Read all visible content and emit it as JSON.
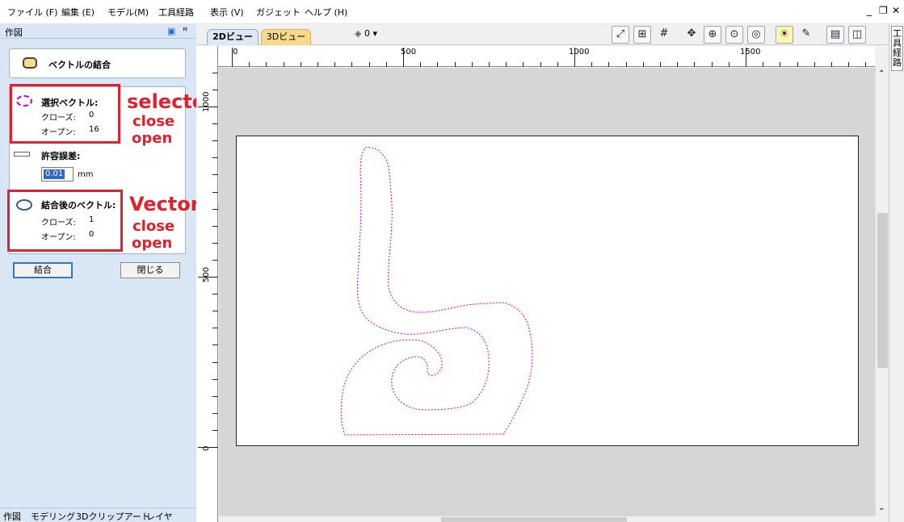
{
  "menu": {
    "items": [
      "ファイル (F)",
      "編集 (E)",
      "モデル(M)",
      "工具経路",
      "表示 (V)",
      "ガジェット",
      "ヘルプ (H)"
    ],
    "window_controls": [
      "_",
      "❐",
      "✕"
    ]
  },
  "panel": {
    "title": "作図",
    "tool_title": "ベクトルの結合",
    "selected": {
      "label": "選択ベクトル:",
      "close_label": "クローズ:",
      "close_value": "0",
      "open_label": "オープン:",
      "open_value": "16"
    },
    "tolerance": {
      "label": "許容誤差:",
      "value": "0.01",
      "unit": "mm"
    },
    "result": {
      "label": "結合後のベクトル:",
      "close_label": "クローズ:",
      "close_value": "1",
      "open_label": "オープン:",
      "open_value": "0"
    },
    "join_button": "結合",
    "close_button": "閉じる"
  },
  "annotations": {
    "selected_title": "selected vector",
    "selected_close": "close",
    "selected_open": "open",
    "result_title": "Vector after united",
    "result_close": "close",
    "result_open": "open"
  },
  "bottom_tabs": [
    "作図",
    "モデリング",
    "3Dクリップアート",
    "レイヤ"
  ],
  "right_tab": "工具経路",
  "view_tabs": [
    "2Dビュー",
    "3Dビュー"
  ],
  "layer_selector": "0",
  "ruler": {
    "h_labels": [
      "0",
      "500",
      "1000",
      "1500"
    ],
    "v_labels": [
      "1000",
      "500",
      "0"
    ]
  },
  "colors": {
    "annotation": "#e0222c",
    "vector": "#cc00cc",
    "panel": "#d9e6f4"
  }
}
